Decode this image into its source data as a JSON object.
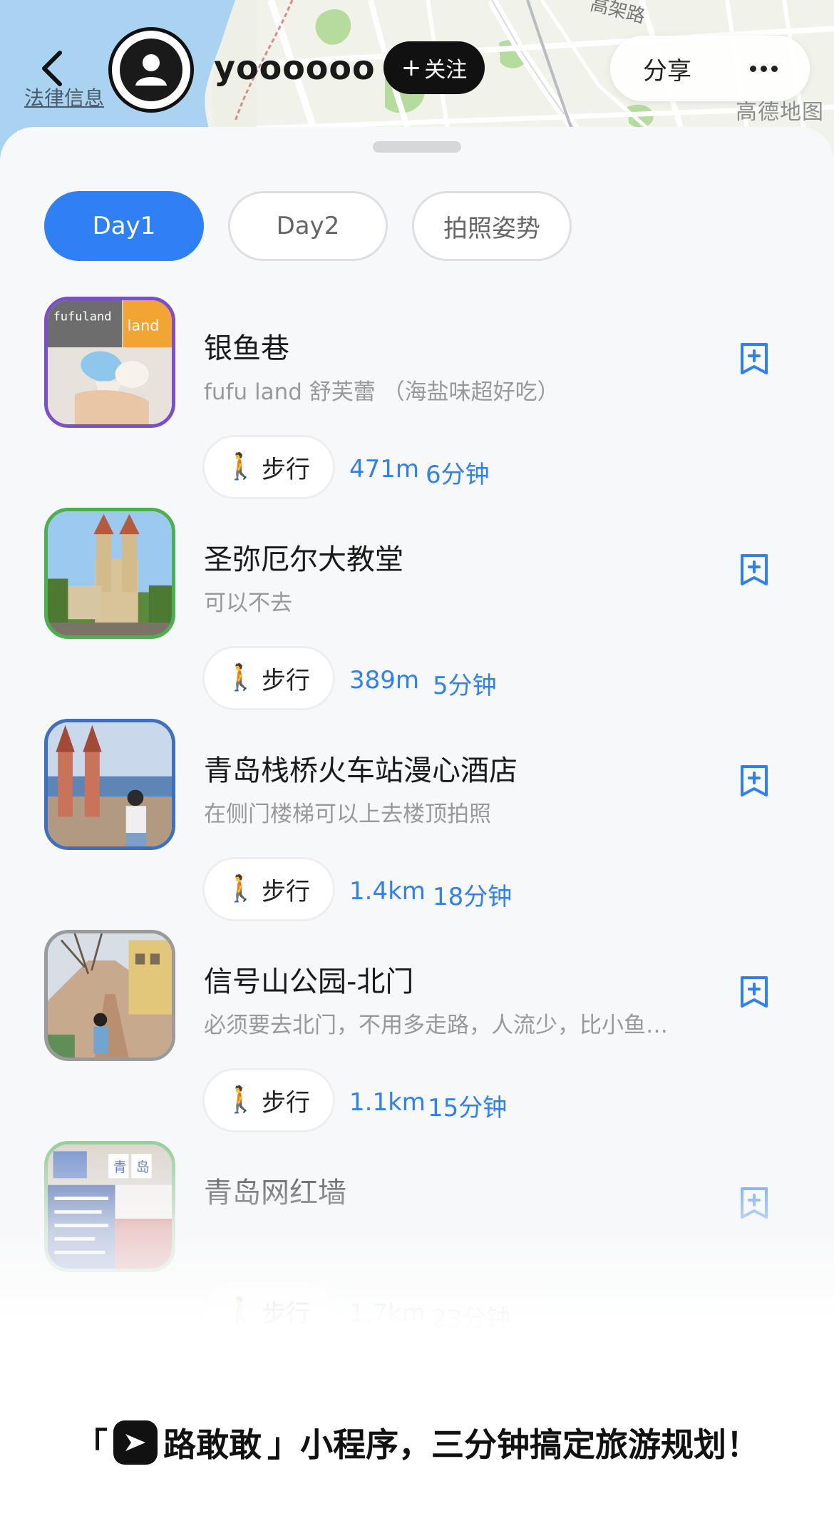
{
  "header": {
    "back_label": "",
    "legal_link": "法律信息",
    "username": "yoooooo",
    "follow_label": "关注",
    "share_label": "分享",
    "map_credit": "高德地图",
    "map_road_label": "高架路"
  },
  "tabs": [
    {
      "label": "Day1",
      "active": true
    },
    {
      "label": "Day2",
      "active": false
    },
    {
      "label": "拍照姿势",
      "active": false
    }
  ],
  "pois": [
    {
      "title": "银鱼巷",
      "note": "fufu land 舒芙蕾 （海盐味超好吃）",
      "mode": "步行",
      "distance": "471m",
      "time": "6分钟",
      "thumb_border": "#7a4fc9",
      "thumb_text_1": "fufuland",
      "thumb_text_2": "land"
    },
    {
      "title": "圣弥厄尔大教堂",
      "note": "可以不去",
      "mode": "步行",
      "distance": "389m",
      "time": "5分钟",
      "thumb_border": "#4caf50"
    },
    {
      "title": "青岛栈桥火车站漫心酒店",
      "note": "在侧门楼梯可以上去楼顶拍照",
      "mode": "步行",
      "distance": "1.4km",
      "time": "18分钟",
      "thumb_border": "#3f6fbf"
    },
    {
      "title": "信号山公园-北门",
      "note": "必须要去北门，不用多走路，人流少，比小鱼…",
      "mode": "步行",
      "distance": "1.1km",
      "time": "15分钟",
      "thumb_border": "#9a9a9a"
    },
    {
      "title": "青岛网红墙",
      "note": "",
      "mode": "步行",
      "distance": "1.7km",
      "time": "23分钟",
      "thumb_border": "#8cc98f",
      "thumb_text_1": "青",
      "thumb_text_2": "岛"
    }
  ],
  "promo": {
    "open_quote": "「",
    "app_name": "路敢敢",
    "close_text": "」小程序，三分钟搞定旅游规划！"
  },
  "colors": {
    "accent": "#2f7ff5",
    "tab_active_bg": "#2f7ff5",
    "follow_bg": "#111111"
  }
}
